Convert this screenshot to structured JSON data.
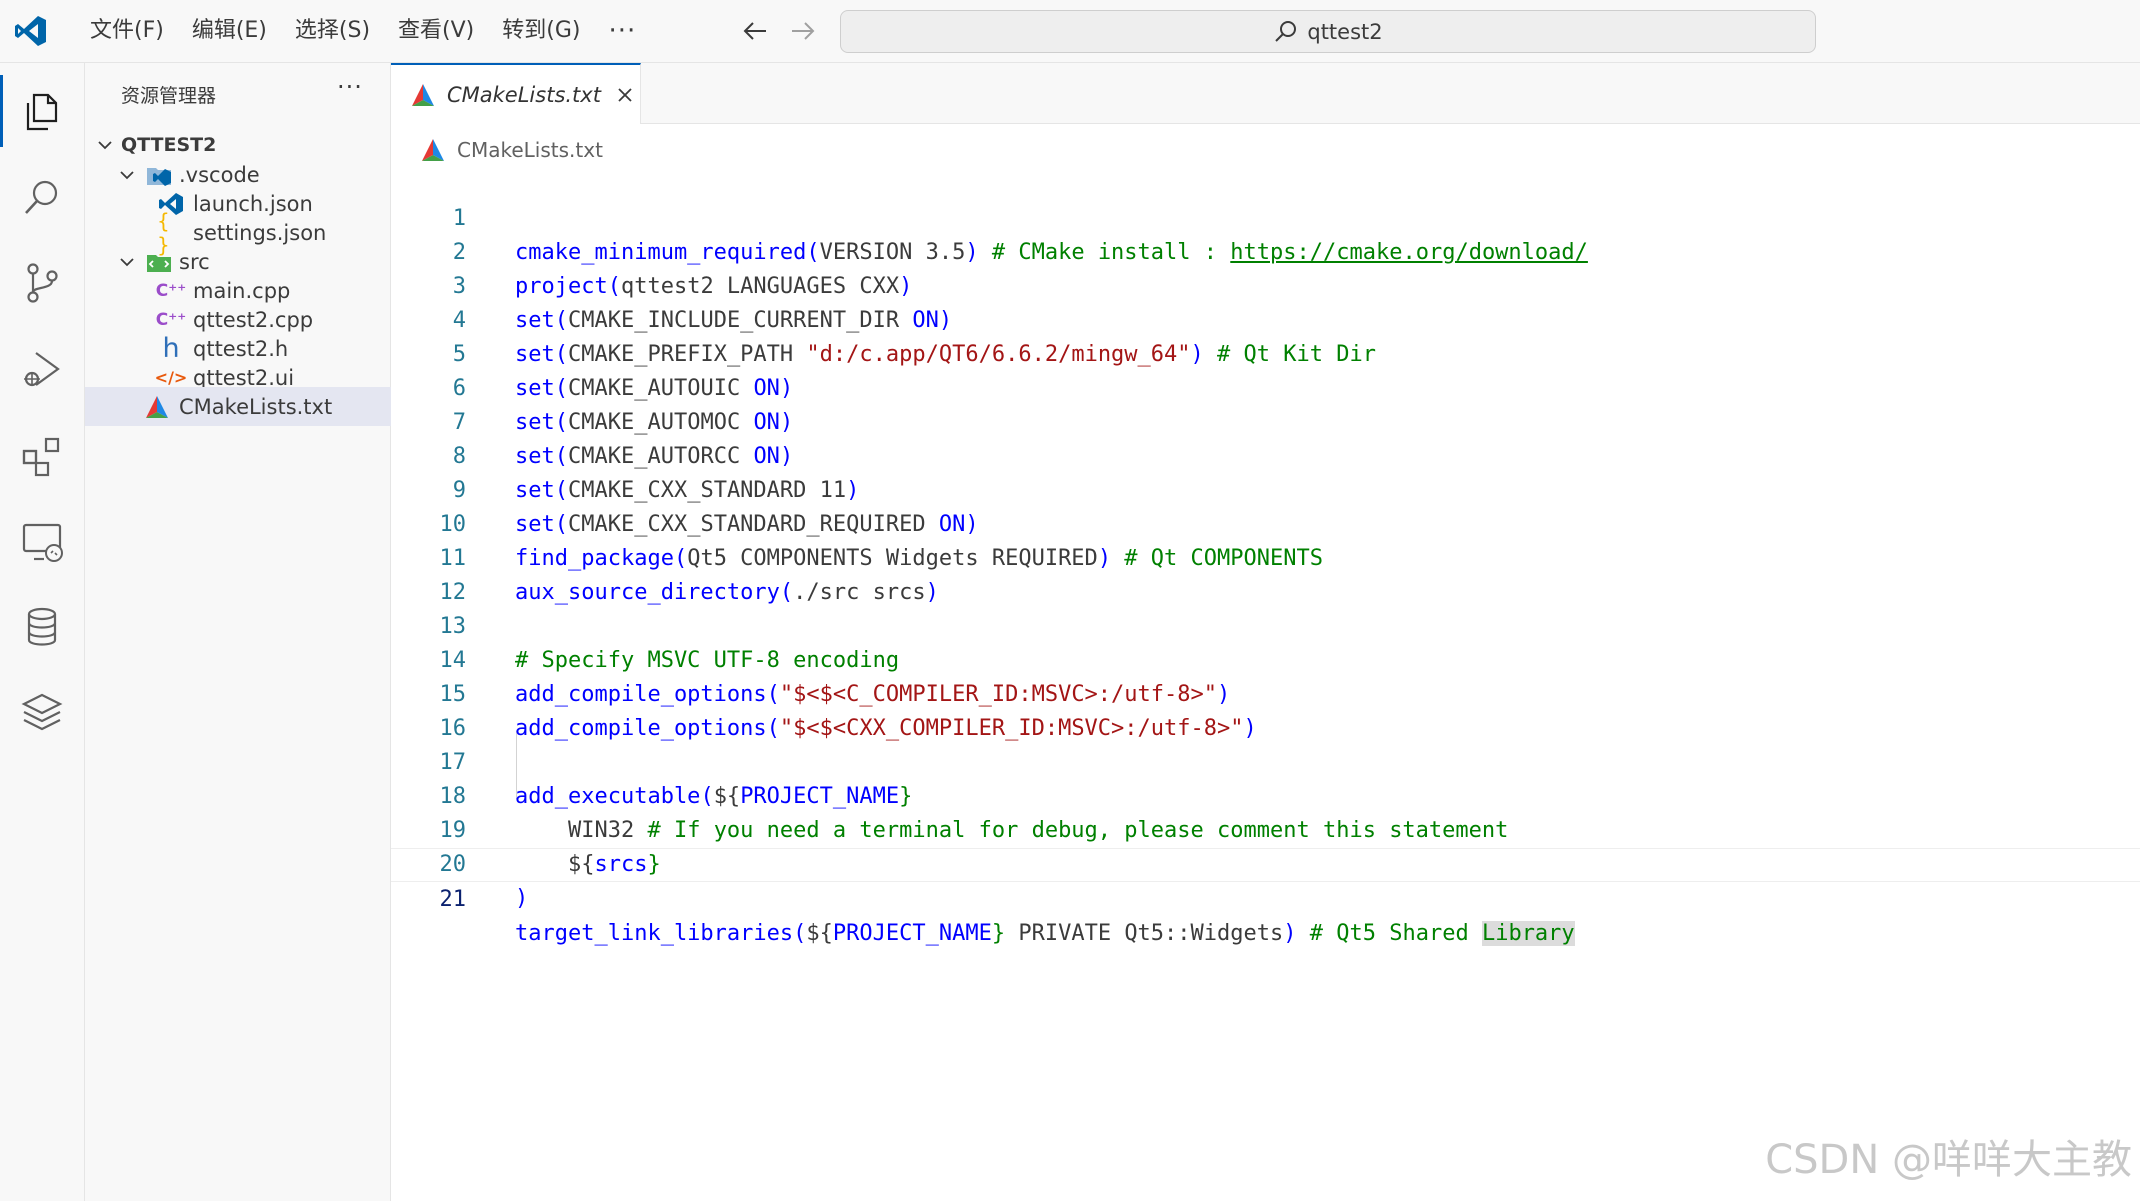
{
  "menu": {
    "items": [
      "文件(F)",
      "编辑(E)",
      "选择(S)",
      "查看(V)",
      "转到(G)"
    ],
    "more": "···"
  },
  "command_center": {
    "text": "qttest2"
  },
  "activity_bar": {
    "icons": [
      "explorer-icon",
      "search-icon",
      "source-control-icon",
      "run-debug-icon",
      "extensions-icon",
      "remote-explorer-icon",
      "database-icon",
      "layers-icon"
    ]
  },
  "explorer": {
    "title": "资源管理器",
    "more": "···",
    "root": "QTTEST2",
    "items": [
      {
        "label": ".vscode",
        "icon": "vscode-folder-icon"
      },
      {
        "label": "launch.json",
        "icon": "vscode-file-icon"
      },
      {
        "label": "settings.json",
        "icon": "json-braces-icon"
      },
      {
        "label": "src",
        "icon": "src-folder-icon"
      },
      {
        "label": "main.cpp",
        "icon": "cpp-icon"
      },
      {
        "label": "qttest2.cpp",
        "icon": "cpp-icon"
      },
      {
        "label": "qttest2.h",
        "icon": "header-h-icon"
      },
      {
        "label": "qttest2.ui",
        "icon": "ui-xml-icon"
      },
      {
        "label": "CMakeLists.txt",
        "icon": "cmake-icon"
      }
    ]
  },
  "editor": {
    "tab_label": "CMakeLists.txt",
    "breadcrumb": "CMakeLists.txt",
    "line_numbers": [
      "1",
      "2",
      "3",
      "4",
      "5",
      "6",
      "7",
      "8",
      "9",
      "10",
      "11",
      "12",
      "13",
      "14",
      "15",
      "16",
      "17",
      "18",
      "19",
      "20",
      "21"
    ],
    "code": {
      "l1a": "cmake_minimum_required",
      "l1b": "(",
      "l1c": "VERSION 3.5",
      "l1d": ")",
      "l1e": " # CMake install : ",
      "l1f": "https://cmake.org/download/",
      "l2a": "project",
      "l2b": "(",
      "l2c": "qttest2 LANGUAGES CXX",
      "l2d": ")",
      "l3a": "set",
      "l3b": "(",
      "l3c": "CMAKE_INCLUDE_CURRENT_DIR ",
      "l3d": "ON",
      "l3e": ")",
      "l4a": "set",
      "l4b": "(",
      "l4c": "CMAKE_PREFIX_PATH ",
      "l4d": "\"d:/c.app/QT6/6.6.2/mingw_64\"",
      "l4e": ")",
      "l4f": " # Qt Kit Dir",
      "l5a": "set",
      "l5b": "(",
      "l5c": "CMAKE_AUTOUIC ",
      "l5d": "ON",
      "l5e": ")",
      "l6a": "set",
      "l6b": "(",
      "l6c": "CMAKE_AUTOMOC ",
      "l6d": "ON",
      "l6e": ")",
      "l7a": "set",
      "l7b": "(",
      "l7c": "CMAKE_AUTORCC ",
      "l7d": "ON",
      "l7e": ")",
      "l8a": "set",
      "l8b": "(",
      "l8c": "CMAKE_CXX_STANDARD 11",
      "l8e": ")",
      "l9a": "set",
      "l9b": "(",
      "l9c": "CMAKE_CXX_STANDARD_REQUIRED ",
      "l9d": "ON",
      "l9e": ")",
      "l10a": "find_package",
      "l10b": "(",
      "l10c": "Qt5 COMPONENTS Widgets REQUIRED",
      "l10d": ")",
      "l10e": " # Qt COMPONENTS",
      "l11a": "aux_source_directory",
      "l11b": "(",
      "l11c": "./src srcs",
      "l11d": ")",
      "l13a": "# Specify MSVC UTF-8 encoding",
      "l14a": "add_compile_options",
      "l14b": "(",
      "l14c": "\"$<$<C_COMPILER_ID:MSVC>:/utf-8>\"",
      "l14d": ")",
      "l15a": "add_compile_options",
      "l15b": "(",
      "l15c": "\"$<$<CXX_COMPILER_ID:MSVC>:/utf-8>\"",
      "l15d": ")",
      "l17a": "add_executable",
      "l17b": "(",
      "l17c": "${",
      "l17d": "PROJECT_NAME",
      "l17e": "}",
      "l18a": "    WIN32",
      "l18b": " # If you need a terminal for debug, please comment this statement",
      "l19a": "    ${",
      "l19b": "srcs",
      "l19c": "}",
      "l20a": ")",
      "l21a": "target_link_libraries",
      "l21b": "(",
      "l21c": "${",
      "l21d": "PROJECT_NAME",
      "l21e": "}",
      "l21f": " PRIVATE Qt5::Widgets",
      "l21g": ")",
      "l21h": " # Qt5 Shared ",
      "l21i": "Library"
    }
  },
  "watermark": "CSDN @咩咩大主教",
  "colors": {
    "accent": "#005fb8",
    "keyword": "#0000ff",
    "string": "#a31515",
    "comment": "#008000"
  }
}
